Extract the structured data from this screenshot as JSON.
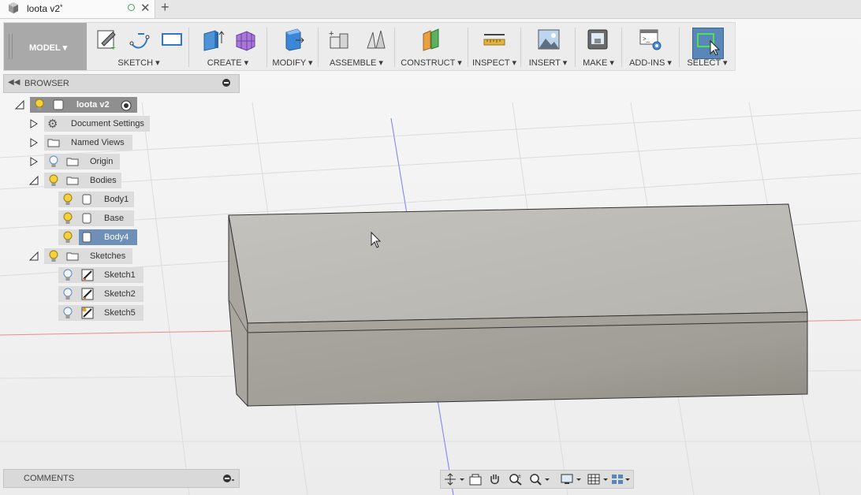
{
  "document": {
    "title": "loota v2",
    "modified_marker": "*"
  },
  "toolbar": {
    "workspace_label": "MODEL ▾",
    "groups": [
      {
        "label": "SKETCH ▾"
      },
      {
        "label": "CREATE ▾"
      },
      {
        "label": "MODIFY ▾"
      },
      {
        "label": "ASSEMBLE ▾"
      },
      {
        "label": "CONSTRUCT ▾"
      },
      {
        "label": "INSPECT ▾"
      },
      {
        "label": "INSERT ▾"
      },
      {
        "label": "MAKE ▾"
      },
      {
        "label": "ADD-INS ▾"
      },
      {
        "label": "SELECT ▾"
      }
    ]
  },
  "browser": {
    "title": "BROWSER",
    "root": "loota v2",
    "items": [
      {
        "label": "Document Settings"
      },
      {
        "label": "Named Views"
      },
      {
        "label": "Origin"
      },
      {
        "label": "Bodies"
      },
      {
        "label": "Body1"
      },
      {
        "label": "Base"
      },
      {
        "label": "Body4"
      },
      {
        "label": "Sketches"
      },
      {
        "label": "Sketch1"
      },
      {
        "label": "Sketch2"
      },
      {
        "label": "Sketch5"
      }
    ]
  },
  "comments": {
    "title": "COMMENTS"
  },
  "colors": {
    "accent_select": "#6d8fb8",
    "axis_red": "#e06a6a",
    "axis_blue": "#6a6af0",
    "model_gray": "#b9b7b1"
  }
}
